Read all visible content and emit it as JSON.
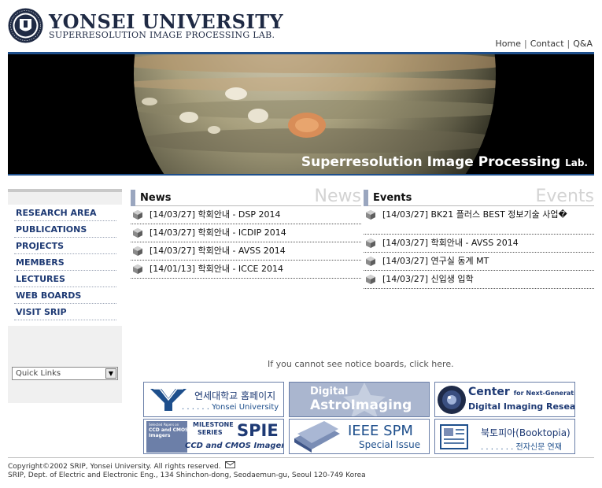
{
  "header": {
    "university": "YONSEI UNIVERSITY",
    "lab": "SUPERRESOLUTION IMAGE PROCESSING LAB.",
    "seal_text": "YONSEI UNIVERSITY",
    "top_links": [
      "Home",
      "Contact",
      "Q&A"
    ]
  },
  "banner": {
    "caption": "Superresolution Image Processing",
    "caption_suffix": "Lab."
  },
  "sidebar": {
    "items": [
      "RESEARCH AREA",
      "PUBLICATIONS",
      "PROJECTS",
      "MEMBERS",
      "LECTURES",
      "WEB BOARDS",
      "VISIT SRIP"
    ],
    "quick_links": "Quick Links"
  },
  "news": {
    "title": "News",
    "ghost": "News",
    "items": [
      "[14/03/27] 학회안내 - DSP 2014",
      "[14/03/27] 학회안내 - ICDIP 2014",
      "[14/03/27] 학회안내 - AVSS 2014",
      "[14/01/13] 학회안내 - ICCE 2014"
    ]
  },
  "events": {
    "title": "Events",
    "ghost": "Events",
    "items": [
      "[14/03/27] BK21 플러스 BEST 정보기술 사업�",
      "[14/03/27] 학회안내 - AVSS 2014",
      "[14/03/27] 연구실 동계 MT",
      "[14/03/27] 신입생 입학"
    ]
  },
  "notice": "If you cannot see notice boards, click here.",
  "link_banners": {
    "yonsei": {
      "line1": "연세대학교 홈페이지",
      "line2": "Yonsei University"
    },
    "astro": {
      "line1": "Digital",
      "line2": "AstroImaging"
    },
    "center": {
      "line1": "Center",
      "line1_small": "for Next-Generation",
      "line2": "Digital Imaging Research"
    },
    "spie": {
      "line1": "MILESTONE",
      "line2": "SERIES",
      "big": "SPIE",
      "line3": "CCD and CMOS Imagers",
      "small1": "Selected Papers on",
      "small2": "CCD and CMOS",
      "small3": "Imagers"
    },
    "ieee": {
      "line1": "IEEE SPM",
      "line2": "Special Issue"
    },
    "booktopia": {
      "line1": "북토피아(Booktopia)",
      "line2": "전자신문 연재"
    }
  },
  "footer": {
    "copyright": "Copyright©2002 SRIP, Yonsei University. All rights reserved.",
    "address": "SRIP, Dept. of Electric and Electronic Eng., 134 Shinchon-dong, Seodaemun-gu, Seoul 120-749 Korea"
  },
  "colors": {
    "brand_navy": "#1f2a44",
    "accent_blue": "#1e4f8c",
    "menu_blue": "#1e3a74"
  }
}
